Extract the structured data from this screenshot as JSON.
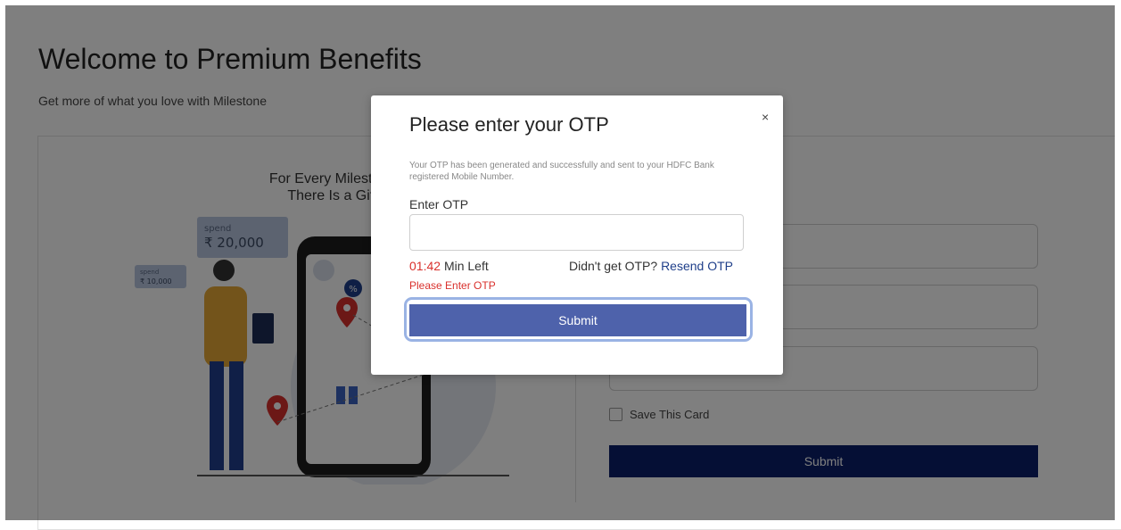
{
  "page": {
    "title": "Welcome to Premium Benefits",
    "subtitle": "Get more of what you love with Milestone"
  },
  "promo": {
    "line1": "For Every Milestone",
    "line2": "There Is a Gift",
    "spend_large_label": "spend",
    "spend_large_amount": "₹ 20,000",
    "spend_small_label": "spend",
    "spend_small_amount": "₹ 10,000"
  },
  "card_form": {
    "save_card_label": "Save This Card",
    "submit_label": "Submit"
  },
  "modal": {
    "title": "Please enter your OTP",
    "close": "×",
    "description": "Your OTP has been generated and successfully and sent to your HDFC Bank registered Mobile Number.",
    "otp_label": "Enter OTP",
    "otp_value": "",
    "timer_value": "01:42",
    "timer_suffix": "Min Left",
    "resend_prompt": "Didn't get OTP?",
    "resend_link": "Resend OTP",
    "error": "Please Enter OTP",
    "submit_label": "Submit"
  },
  "colors": {
    "overlay": "rgba(0,0,0,0.5)",
    "primary_dark": "#0a1f6b",
    "modal_button": "#4e62ab",
    "error": "#d9302c",
    "link": "#1f3f8a"
  }
}
